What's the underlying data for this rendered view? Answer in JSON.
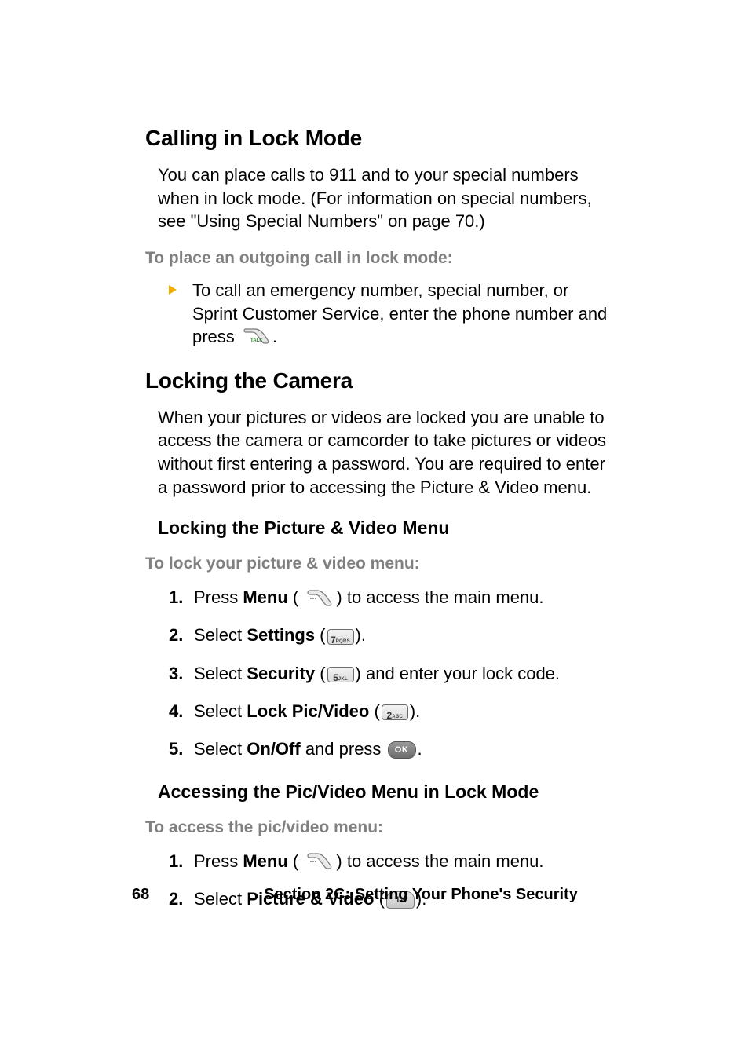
{
  "h1": "Calling in Lock Mode",
  "p1": "You can place calls to 911 and to your special numbers when in lock mode. (For information on special numbers, see \"Using Special Numbers\" on page 70.)",
  "lead1": "To place an outgoing call in lock mode:",
  "bullet1_a": "To call an emergency number, special number, or Sprint Customer Service, enter the phone number and press ",
  "bullet1_b": ".",
  "h2": "Locking the Camera",
  "p2": "When your pictures or videos are locked you are unable to access the camera or camcorder to take pictures or videos without first entering a password. You are required to enter a password prior to accessing the Picture & Video menu.",
  "sh1": "Locking the Picture & Video Menu",
  "lead2": "To lock your picture & video menu:",
  "steps1": {
    "s1_a": "Press ",
    "s1_menu": "Menu",
    "s1_b": " (",
    "s1_c": ") to access the main menu.",
    "s2_a": "Select ",
    "s2_b": "Settings",
    "s2_c": " (",
    "s2_d": ").",
    "s3_a": "Select ",
    "s3_b": "Security",
    "s3_c": " (",
    "s3_d": ") and enter your lock code.",
    "s4_a": "Select ",
    "s4_b": "Lock Pic/Video",
    "s4_c": " (",
    "s4_d": ").",
    "s5_a": "Select ",
    "s5_b": "On/Off",
    "s5_c": " and press ",
    "s5_d": "."
  },
  "sh2": "Accessing the Pic/Video Menu in Lock Mode",
  "lead3": "To access the pic/video menu:",
  "steps2": {
    "s1_a": "Press ",
    "s1_menu": "Menu",
    "s1_b": " (",
    "s1_c": ") to access the main menu.",
    "s2_a": "Select ",
    "s2_b": "Picture & Video",
    "s2_c": " (",
    "s2_d": ")."
  },
  "keys": {
    "seven_big": "7",
    "seven_small": "PQRS",
    "five_big": "5",
    "five_small": "JKL",
    "two_big": "2",
    "two_small": "ABC",
    "one_big": "1",
    "ok": "OK",
    "talk": "TALK"
  },
  "footer": {
    "page": "68",
    "section": "Section 2C: Setting Your Phone's Security"
  }
}
